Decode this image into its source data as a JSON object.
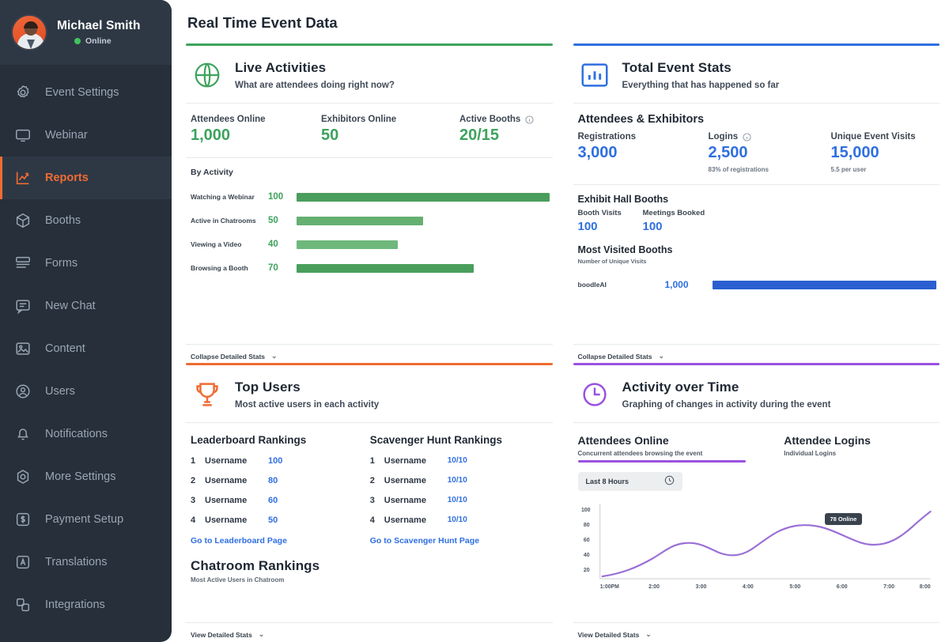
{
  "sidebar": {
    "profile": {
      "name": "Michael Smith",
      "status": "Online"
    },
    "items": [
      {
        "label": "Event Settings",
        "icon": "gear-icon"
      },
      {
        "label": "Webinar",
        "icon": "monitor-icon"
      },
      {
        "label": "Reports",
        "icon": "chart-line-icon",
        "active": true
      },
      {
        "label": "Booths",
        "icon": "cube-icon"
      },
      {
        "label": "Forms",
        "icon": "forms-icon"
      },
      {
        "label": "New Chat",
        "icon": "chat-icon"
      },
      {
        "label": "Content",
        "icon": "image-icon"
      },
      {
        "label": "Users",
        "icon": "user-circle-icon"
      },
      {
        "label": "Notifications",
        "icon": "bell-icon"
      },
      {
        "label": "More Settings",
        "icon": "hexagon-gear-icon"
      },
      {
        "label": "Payment Setup",
        "icon": "dollar-square-icon"
      },
      {
        "label": "Translations",
        "icon": "letter-a-square-icon"
      },
      {
        "label": "Integrations",
        "icon": "integrations-icon"
      }
    ]
  },
  "page": {
    "title": "Real Time Event Data"
  },
  "colors": {
    "green": "#3da35d",
    "blue": "#2f6fe0",
    "orange": "#ef6c33",
    "purple": "#9b51e0"
  },
  "live_activities": {
    "accent": "#3da35d",
    "title": "Live Activities",
    "subtitle": "What are attendees doing right now?",
    "stats": [
      {
        "label": "Attendees Online",
        "value": "1,000"
      },
      {
        "label": "Exhibitors Online",
        "value": "50"
      },
      {
        "label": "Active Booths",
        "value": "20/15",
        "has_info": true
      }
    ],
    "by_activity_label": "By Activity",
    "footer": "Collapse Detailed Stats"
  },
  "total_event_stats": {
    "accent": "#2f6fe0",
    "title": "Total Event Stats",
    "subtitle": "Everything that has happened so far",
    "section_title": "Attendees & Exhibitors",
    "stats": [
      {
        "label": "Registrations",
        "value": "3,000",
        "note": ""
      },
      {
        "label": "Logins",
        "value": "2,500",
        "note": "83% of registrations",
        "has_info": true
      },
      {
        "label": "Unique Event Visits",
        "value": "15,000",
        "note": "5.5 per user"
      }
    ],
    "booths_title": "Exhibit Hall Booths",
    "booth_stats": [
      {
        "label": "Booth Visits",
        "value": "100"
      },
      {
        "label": "Meetings Booked",
        "value": "100"
      }
    ],
    "most_visited_title": "Most Visited Booths",
    "most_visited_sub": "Number of Unique Visits",
    "footer": "Collapse Detailed Stats"
  },
  "top_users": {
    "accent": "#ef6c33",
    "title": "Top Users",
    "subtitle": "Most active users in each activity",
    "leaderboard": {
      "title": "Leaderboard Rankings",
      "rows": [
        {
          "rank": "1",
          "user": "Username",
          "value": "100"
        },
        {
          "rank": "2",
          "user": "Username",
          "value": "80"
        },
        {
          "rank": "3",
          "user": "Username",
          "value": "60"
        },
        {
          "rank": "4",
          "user": "Username",
          "value": "50"
        }
      ],
      "link": "Go to Leaderboard Page"
    },
    "scavenger": {
      "title": "Scavenger Hunt Rankings",
      "rows": [
        {
          "rank": "1",
          "user": "Username",
          "value": "10/10"
        },
        {
          "rank": "2",
          "user": "Username",
          "value": "10/10"
        },
        {
          "rank": "3",
          "user": "Username",
          "value": "10/10"
        },
        {
          "rank": "4",
          "user": "Username",
          "value": "10/10"
        }
      ],
      "link": "Go to Scavenger Hunt Page"
    },
    "chatroom_title": "Chatroom Rankings",
    "chatroom_sub": "Most Active Users in Chatroom",
    "footer": "View Detailed Stats"
  },
  "activity_over_time": {
    "accent": "#9b51e0",
    "title": "Activity over Time",
    "subtitle": "Graphing of changes in activity during the event",
    "tabs": [
      {
        "title": "Attendees Online",
        "sub": "Concurrent attendees browsing the event",
        "active": true
      },
      {
        "title": "Attendee Logins",
        "sub": "Individual Logins",
        "active": false
      }
    ],
    "range": {
      "label": "Last 8 Hours",
      "icon": "clock-icon"
    },
    "tooltip": "78 Online",
    "footer": "View Detailed Stats"
  },
  "chart_data": [
    {
      "type": "bar",
      "title": "By Activity",
      "orientation": "horizontal",
      "categories": [
        "Watching a Webinar",
        "Active in Chatrooms",
        "Viewing a Video",
        "Browsing a Booth"
      ],
      "values": [
        100,
        50,
        40,
        70
      ],
      "xlim": [
        0,
        100
      ],
      "color": "#4a9e5c",
      "grid": false,
      "legend": false
    },
    {
      "type": "bar",
      "title": "Most Visited Booths",
      "subtitle": "Number of Unique Visits",
      "orientation": "horizontal",
      "categories": [
        "boodleAI"
      ],
      "values": [
        1000
      ],
      "value_labels": [
        "1,000"
      ],
      "xlim": [
        0,
        1000
      ],
      "color": "#2b5fd0",
      "grid": false,
      "legend": false
    },
    {
      "type": "line",
      "title": "Attendees Online",
      "subtitle": "Concurrent attendees browsing the event",
      "xlabel": "",
      "ylabel": "",
      "x": [
        "1:00PM",
        "2:00",
        "3:00",
        "4:00",
        "5:00",
        "6:00",
        "7:00",
        "8:00"
      ],
      "series": [
        {
          "name": "Attendees Online",
          "values": [
            10,
            28,
            46,
            37,
            60,
            72,
            56,
            77
          ],
          "color": "#9b6fd6"
        }
      ],
      "ylim": [
        0,
        100
      ],
      "yticks": [
        20,
        40,
        60,
        80,
        100
      ],
      "annotation": "78 Online",
      "grid": false,
      "legend": false
    }
  ]
}
